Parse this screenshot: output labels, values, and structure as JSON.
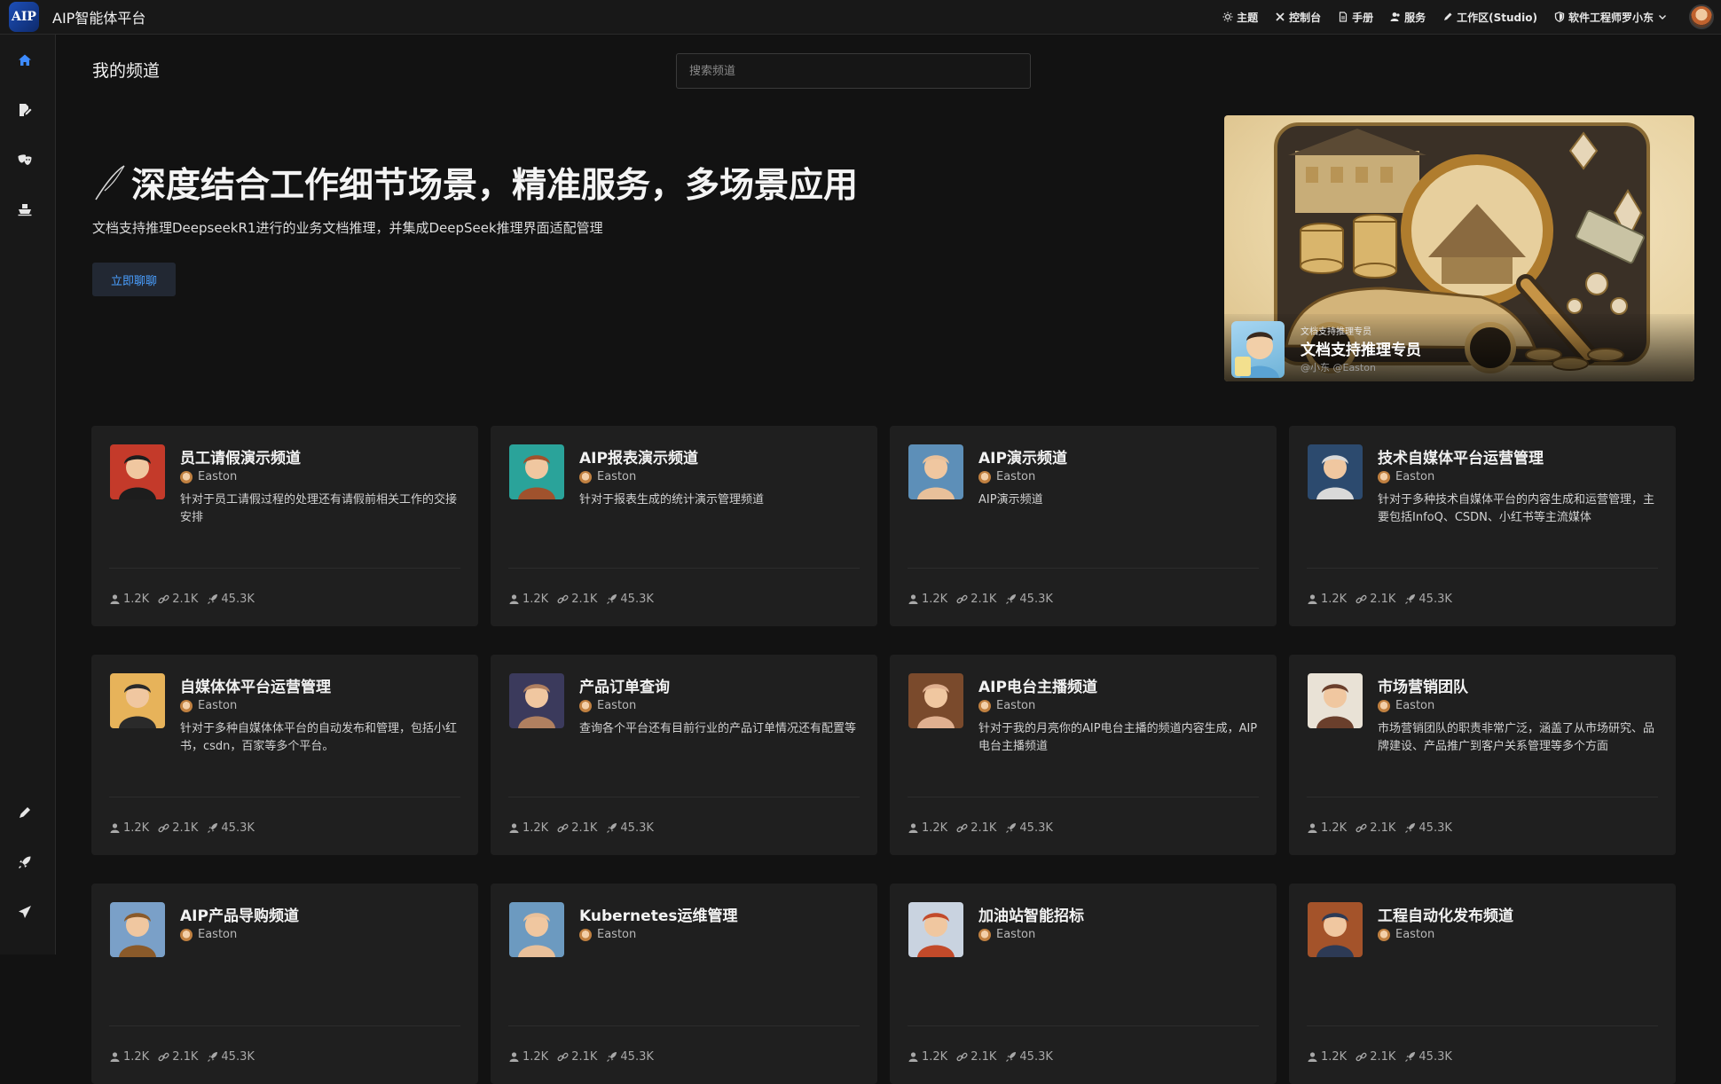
{
  "app": {
    "logo_text": "AIP",
    "title": "AIP智能体平台"
  },
  "topnav": [
    {
      "label": "主题",
      "icon": "sun-icon"
    },
    {
      "label": "控制台",
      "icon": "tools-icon"
    },
    {
      "label": "手册",
      "icon": "document-icon"
    },
    {
      "label": "服务",
      "icon": "users-icon"
    },
    {
      "label": "工作区(Studio)",
      "icon": "pencil-icon"
    },
    {
      "label": "软件工程师罗小东",
      "icon": "shield-icon"
    }
  ],
  "sidebar": [
    "home-icon",
    "edit-document-icon",
    "mask-icon",
    "ship-icon",
    "pen-icon",
    "rocket-icon",
    "send-icon"
  ],
  "page": {
    "title": "我的频道",
    "search_placeholder": "搜索频道"
  },
  "hero": {
    "headline": "深度结合工作细节场景，精准服务，多场景应用",
    "description": "文档支持推理DeepseekR1进行的业务文档推理，并集成DeepSeek推理界面适配管理",
    "button": "立即聊聊"
  },
  "banner": {
    "kicker": "文档支持推理专员",
    "name": "文档支持推理专员",
    "author": "@小东 @Easton"
  },
  "channels": [
    {
      "title": "员工请假演示频道",
      "author": "Easton",
      "desc": "针对于员工请假过程的处理还有请假前相关工作的交接安排",
      "members": "1.2K",
      "links": "2.1K",
      "posts": "45.3K",
      "avatar_colors": [
        "#c43a2a",
        "#1d1d1d"
      ]
    },
    {
      "title": "AIP报表演示频道",
      "author": "Easton",
      "desc": "针对于报表生成的统计演示管理频道",
      "members": "1.2K",
      "links": "2.1K",
      "posts": "45.3K",
      "avatar_colors": [
        "#2aa39a",
        "#a0522d"
      ]
    },
    {
      "title": "AIP演示频道",
      "author": "Easton",
      "desc": "AIP演示频道",
      "members": "1.2K",
      "links": "2.1K",
      "posts": "45.3K",
      "avatar_colors": [
        "#5d8fb8",
        "#e8c09a"
      ]
    },
    {
      "title": "技术自媒体平台运营管理",
      "author": "Easton",
      "desc": "针对于多种技术自媒体平台的内容生成和运营管理，主要包括InfoQ、CSDN、小红书等主流媒体",
      "members": "1.2K",
      "links": "2.1K",
      "posts": "45.3K",
      "avatar_colors": [
        "#2c4a6e",
        "#d9d9d9"
      ]
    },
    {
      "title": "自媒体体平台运营管理",
      "author": "Easton",
      "desc": "针对于多种自媒体体平台的自动发布和管理，包括小红书，csdn，百家等多个平台。",
      "members": "1.2K",
      "links": "2.1K",
      "posts": "45.3K",
      "avatar_colors": [
        "#e7b35a",
        "#2a2a2a"
      ]
    },
    {
      "title": "产品订单查询",
      "author": "Easton",
      "desc": "查询各个平台还有目前行业的产品订单情况还有配置等",
      "members": "1.2K",
      "links": "2.1K",
      "posts": "45.3K",
      "avatar_colors": [
        "#3b3a5c",
        "#b08060"
      ]
    },
    {
      "title": "AIP电台主播频道",
      "author": "Easton",
      "desc": "针对于我的月亮你的AIP电台主播的频道内容生成，AIP电台主播频道",
      "members": "1.2K",
      "links": "2.1K",
      "posts": "45.3K",
      "avatar_colors": [
        "#7a4a2c",
        "#e0b090"
      ]
    },
    {
      "title": "市场营销团队",
      "author": "Easton",
      "desc": "市场营销团队的职责非常广泛，涵盖了从市场研究、品牌建设、产品推广到客户关系管理等多个方面",
      "members": "1.2K",
      "links": "2.1K",
      "posts": "45.3K",
      "avatar_colors": [
        "#e9e2d6",
        "#6a3f2c"
      ]
    },
    {
      "title": "AIP产品导购频道",
      "author": "Easton",
      "desc": "",
      "members": "1.2K",
      "links": "2.1K",
      "posts": "45.3K",
      "avatar_colors": [
        "#7aa0c8",
        "#8a5a2a"
      ]
    },
    {
      "title": "Kubernetes运维管理",
      "author": "Easton",
      "desc": "",
      "members": "1.2K",
      "links": "2.1K",
      "posts": "45.3K",
      "avatar_colors": [
        "#6c9ac0",
        "#e8c09a"
      ]
    },
    {
      "title": "加油站智能招标",
      "author": "Easton",
      "desc": "",
      "members": "1.2K",
      "links": "2.1K",
      "posts": "45.3K",
      "avatar_colors": [
        "#c9d3e0",
        "#c24a2a"
      ]
    },
    {
      "title": "工程自动化发布频道",
      "author": "Easton",
      "desc": "",
      "members": "1.2K",
      "links": "2.1K",
      "posts": "45.3K",
      "avatar_colors": [
        "#a4532a",
        "#2d3a55"
      ]
    }
  ]
}
